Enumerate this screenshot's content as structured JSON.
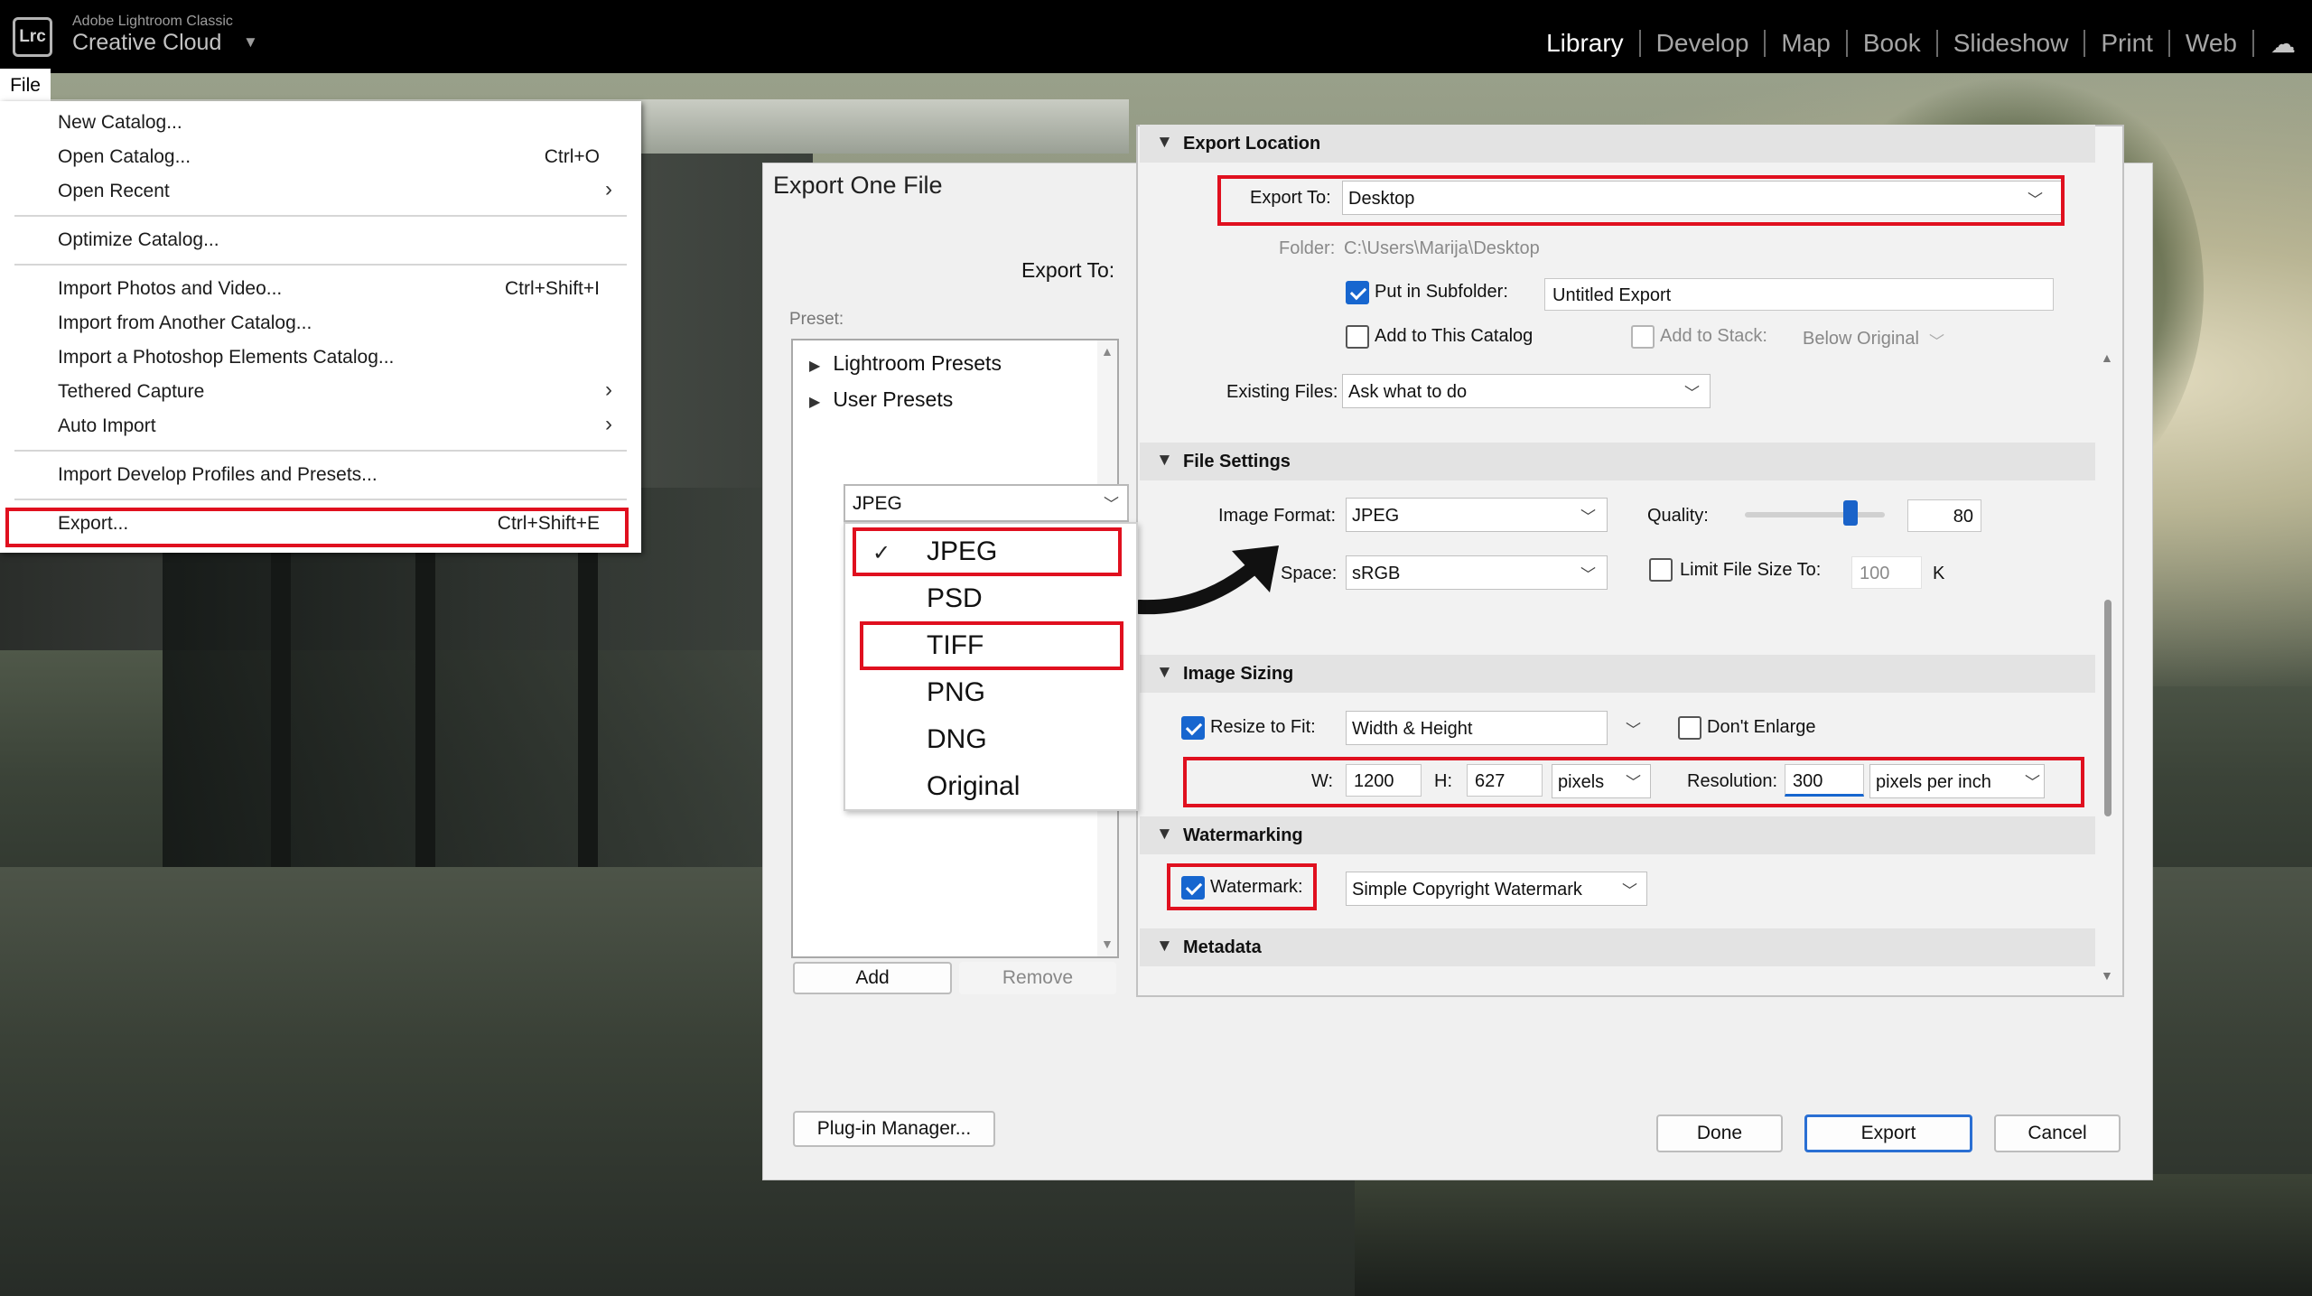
{
  "app": {
    "subtitle": "Adobe Lightroom Classic",
    "name": "Creative Cloud",
    "logo": "Lrc"
  },
  "modules": [
    "Library",
    "Develop",
    "Map",
    "Book",
    "Slideshow",
    "Print",
    "Web"
  ],
  "active_module": "Library",
  "file_menu": {
    "tab": "File",
    "items": [
      {
        "label": "New Catalog...",
        "shortcut": ""
      },
      {
        "label": "Open Catalog...",
        "shortcut": "Ctrl+O"
      },
      {
        "label": "Open Recent",
        "shortcut": ""
      },
      {
        "label": "Optimize Catalog...",
        "shortcut": ""
      },
      {
        "label": "Import Photos and Video...",
        "shortcut": "Ctrl+Shift+I"
      },
      {
        "label": "Import from Another Catalog...",
        "shortcut": ""
      },
      {
        "label": "Import a Photoshop Elements Catalog...",
        "shortcut": ""
      },
      {
        "label": "Tethered Capture",
        "shortcut": ""
      },
      {
        "label": "Auto Import",
        "shortcut": ""
      },
      {
        "label": "Import Develop Profiles and Presets...",
        "shortcut": ""
      },
      {
        "label": "Export...",
        "shortcut": "Ctrl+Shift+E"
      }
    ]
  },
  "dialog": {
    "title": "Export One File",
    "export_to_label": "Export To:",
    "preset_label": "Preset:",
    "presets": [
      "Lightroom Presets",
      "User Presets"
    ],
    "add": "Add",
    "remove": "Remove",
    "plugin_manager": "Plug-in Manager...",
    "done": "Done",
    "export": "Export",
    "cancel": "Cancel"
  },
  "format_dropdown": {
    "selected": "JPEG",
    "options": [
      "JPEG",
      "PSD",
      "TIFF",
      "PNG",
      "DNG",
      "Original"
    ]
  },
  "export_location": {
    "section": "Export Location",
    "export_to_label": "Export To:",
    "export_to": "Desktop",
    "folder_label": "Folder:",
    "folder": "C:\\Users\\Marija\\Desktop",
    "subfolder_label": "Put in Subfolder:",
    "subfolder_checked": true,
    "subfolder": "Untitled Export",
    "add_catalog_label": "Add to This Catalog",
    "add_stack_label": "Add to Stack:",
    "stack_position": "Below Original",
    "existing_label": "Existing Files:",
    "existing": "Ask what to do"
  },
  "file_settings": {
    "section": "File Settings",
    "format_label": "Image Format:",
    "format": "JPEG",
    "quality_label": "Quality:",
    "quality": "80",
    "quality_fraction": 0.8,
    "space_label": "Space:",
    "space": "sRGB",
    "limit_label": "Limit File Size To:",
    "limit": "100",
    "limit_unit": "K"
  },
  "image_sizing": {
    "section": "Image Sizing",
    "resize_label": "Resize to Fit:",
    "resize_mode": "Width & Height",
    "dont_enlarge": "Don't Enlarge",
    "w_label": "W:",
    "w": "1200",
    "h_label": "H:",
    "h": "627",
    "unit": "pixels",
    "resolution_label": "Resolution:",
    "resolution": "300",
    "resolution_unit": "pixels per inch"
  },
  "watermarking": {
    "section": "Watermarking",
    "label": "Watermark:",
    "value": "Simple Copyright Watermark"
  },
  "metadata": {
    "section": "Metadata"
  },
  "colors": {
    "highlight": "#e0101f",
    "accent": "#1766cf"
  }
}
